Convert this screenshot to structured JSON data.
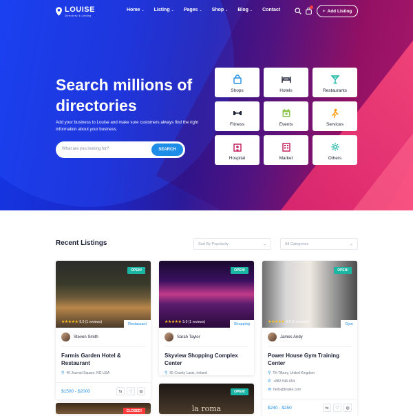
{
  "brand": {
    "name": "LOUISE",
    "tagline": "Directory & Listing"
  },
  "nav": {
    "items": [
      {
        "label": "Home",
        "has_dropdown": true
      },
      {
        "label": "Listing",
        "has_dropdown": true
      },
      {
        "label": "Pages",
        "has_dropdown": true
      },
      {
        "label": "Shop",
        "has_dropdown": true
      },
      {
        "label": "Blog",
        "has_dropdown": true
      },
      {
        "label": "Contact",
        "has_dropdown": false
      }
    ],
    "add_listing": "Add Listing",
    "icons": [
      "search-icon",
      "shopping-bag-icon"
    ]
  },
  "hero": {
    "title": "Search millions of directories",
    "subtitle": "Add your business to Louise and make sure customers always find the right information about your business.",
    "search_placeholder": "What are you looking for?",
    "search_button": "SEARCH"
  },
  "categories": [
    {
      "label": "Shops",
      "icon": "bag-icon",
      "color": "#1e8de8"
    },
    {
      "label": "Hotels",
      "icon": "bed-icon",
      "color": "#1d2136"
    },
    {
      "label": "Restaurants",
      "icon": "cocktail-icon",
      "color": "#1bb5a4"
    },
    {
      "label": "Fitness",
      "icon": "dumbbell-icon",
      "color": "#1d2136"
    },
    {
      "label": "Events",
      "icon": "calendar-icon",
      "color": "#8bc34a"
    },
    {
      "label": "Services",
      "icon": "worker-icon",
      "color": "#ff9800"
    },
    {
      "label": "Hospital",
      "icon": "hospital-icon",
      "color": "#c2185b"
    },
    {
      "label": "Market",
      "icon": "market-icon",
      "color": "#c2185b"
    },
    {
      "label": "Others",
      "icon": "gear-icon",
      "color": "#1bb5a4"
    }
  ],
  "listings_section": {
    "title": "Recent Listings",
    "sort_value": "Sort By Popularity",
    "category_value": "All Categories"
  },
  "listings": [
    {
      "status": "OPEN!",
      "rating": "5.0 (1 reviews)",
      "category": "Restaurant",
      "owner": "Steven Smith",
      "title": "Farmis Garden Hotel & Restaurant",
      "address": "40 Journal Square, NG USA",
      "phone": "",
      "email": "",
      "price": "$1500 - $2000"
    },
    {
      "status": "OPEN!",
      "rating": "5.0 (1 reviews)",
      "category": "Shopping",
      "owner": "Sarah Taylor",
      "title": "Skyview Shopping Complex Center",
      "address": "55 County Laois, Ireland",
      "phone": "",
      "email": "",
      "price": ""
    },
    {
      "status": "OPEN!",
      "rating": "4.5 (2 reviews)",
      "category": "Gym",
      "owner": "James Andy",
      "title": "Power House Gym Training Center",
      "address": "Tilt Tilbury, United Kingdom",
      "phone": "+882-546-654",
      "email": "hello@braike.com",
      "price": "$240 - $250"
    }
  ],
  "more_listings": [
    {
      "status": "CLOSED!"
    },
    {
      "status": "OPEN!",
      "sign": "la roma"
    }
  ],
  "colors": {
    "accent": "#1e8de8",
    "open": "#1bb5a4",
    "closed": "#ff3b3b"
  }
}
